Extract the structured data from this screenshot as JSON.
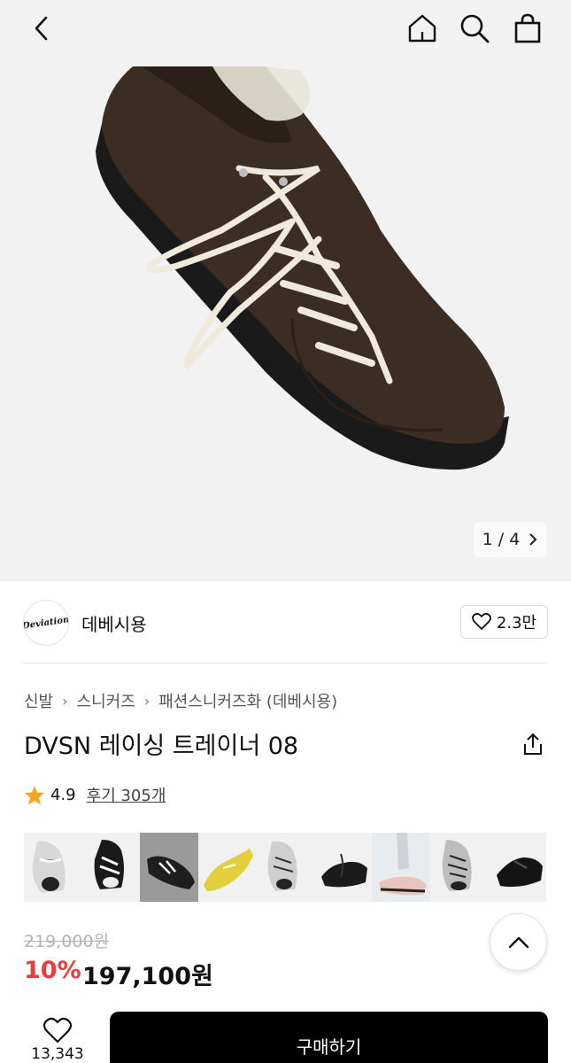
{
  "header": {
    "back_icon": "chevron-left-icon",
    "home_icon": "home-icon",
    "search_icon": "search-icon",
    "bag_icon": "shopping-bag-icon"
  },
  "gallery": {
    "current": "1",
    "separator": "/",
    "total": "4"
  },
  "brand": {
    "logo_text": "Deviation",
    "name": "데베시용",
    "like_count": "2.3만"
  },
  "breadcrumb": [
    "신발",
    "스니커즈",
    "패션스니커즈화 (데베시용)"
  ],
  "product": {
    "title": "DVSN 레이싱 트레이너 08",
    "rating": "4.9",
    "reviews_label": "후기 305개",
    "original_price": "219,000원",
    "discount_rate": "10%",
    "sale_price": "197,100원"
  },
  "thumbnails": [
    {
      "color": "silver-white"
    },
    {
      "color": "black-white"
    },
    {
      "color": "black-suede",
      "selected": true
    },
    {
      "color": "yellow"
    },
    {
      "color": "white-silver"
    },
    {
      "color": "black-lace"
    },
    {
      "color": "pink-beige"
    },
    {
      "color": "silver-black"
    },
    {
      "color": "black-leather"
    }
  ],
  "bottom": {
    "wish_count": "13,343",
    "buy_label": "구매하기"
  },
  "colors": {
    "accent_red": "#ee3b3b",
    "star": "#f5a623",
    "buy_bg": "#000000"
  }
}
